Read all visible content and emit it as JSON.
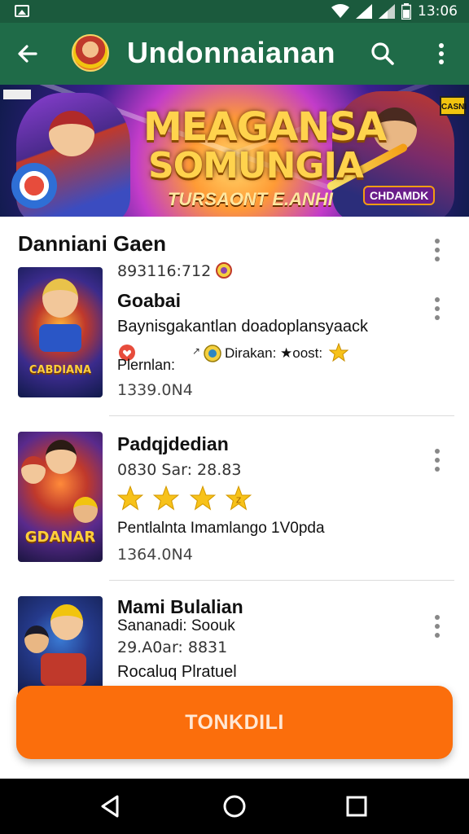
{
  "status_bar": {
    "time": "13:06"
  },
  "app_bar": {
    "title": "Undonnaianan"
  },
  "banner": {
    "title_line1": "MEAGANSA",
    "title_line2": "SOMUNGIA",
    "subtitle": "TURSAONT E.ANHI",
    "badge_right": "CASNI",
    "tag": "CHDAMDK"
  },
  "section": {
    "title": "Danniani Gaen"
  },
  "items": [
    {
      "count": "893116:712",
      "name": "Goabai",
      "description": "Baynisgakantlan doadoplansyaack",
      "meta_left": "Plernlan:",
      "meta_right": "Dirakan: ★oost:",
      "size": "1339.0N4",
      "cover_text": "CABDIANA"
    },
    {
      "name": "Padqjdedian",
      "meta": "0830 Sar: 28.83",
      "rating": 4,
      "description": "Pentlalnta Imamlango 1V0pda",
      "size": "1364.0N4",
      "cover_text": "GDANAR"
    },
    {
      "name": "Mami Bulalian",
      "meta": "Sananadi: Soouk",
      "meta2": "29.A0ar: 8831",
      "description": "Rocaluq Plratuel"
    }
  ],
  "cta": {
    "label": "TONKDILI"
  },
  "colors": {
    "app_bar": "#1f6b48",
    "status_bar": "#1b5a3d",
    "cta": "#fb6e0c",
    "star": "#f7c21a"
  }
}
